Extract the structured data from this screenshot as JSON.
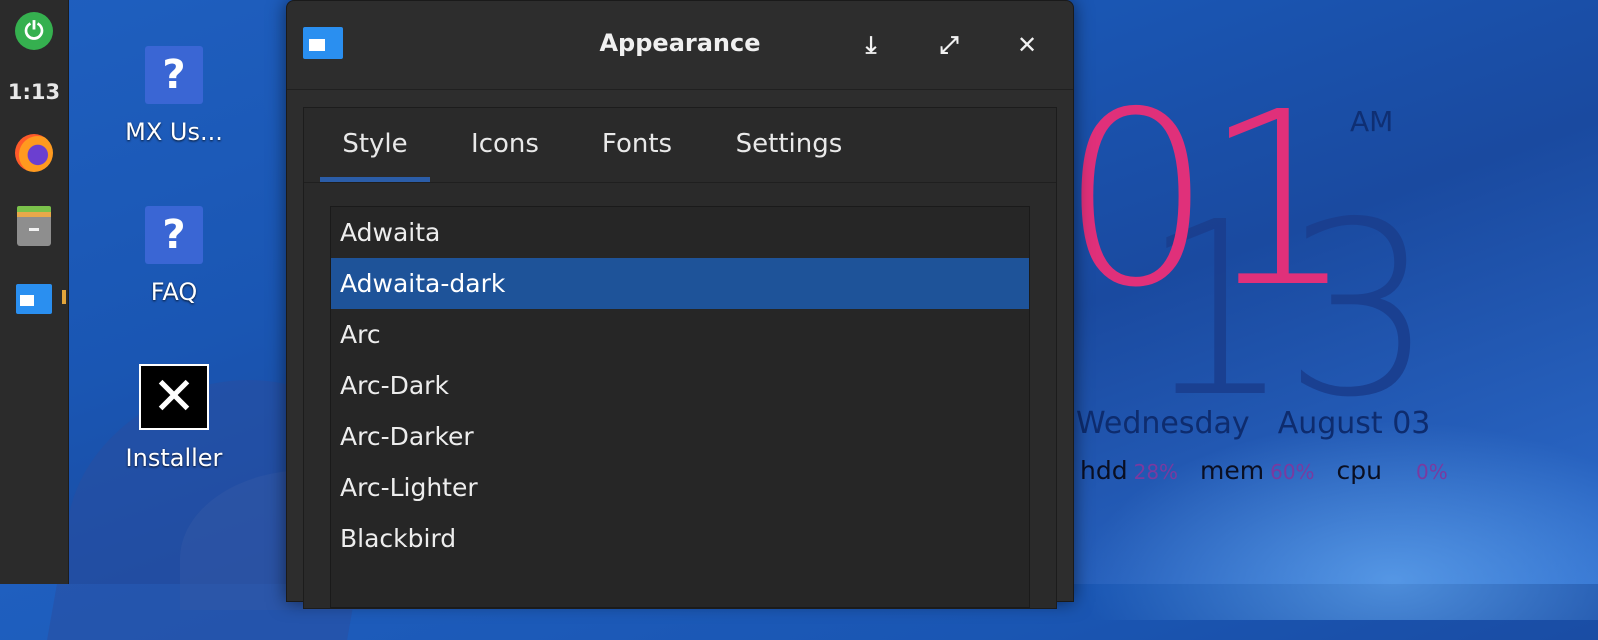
{
  "panel": {
    "clock": "1:13"
  },
  "desktop": {
    "icons": [
      {
        "label": "MX Us...",
        "icon": "question-icon"
      },
      {
        "label": "FAQ",
        "icon": "question-icon"
      },
      {
        "label": "Installer",
        "icon": "mx-installer-icon"
      }
    ]
  },
  "conky": {
    "hour": "01",
    "minute": "13",
    "ampm": "AM",
    "weekday": "Wednesday",
    "date": "August 03",
    "stats": [
      {
        "label": "hdd",
        "value": "28%"
      },
      {
        "label": "mem",
        "value": "60%"
      },
      {
        "label": "cpu",
        "value": "0%"
      }
    ],
    "colors": {
      "hour": "#e0307a",
      "minute": "#1a3f8f",
      "stat_value": "#7a3aa0"
    }
  },
  "window": {
    "title": "Appearance",
    "buttons": {
      "download": "⤓",
      "maximize": "⤢",
      "close": "✕"
    },
    "tabs": [
      "Style",
      "Icons",
      "Fonts",
      "Settings"
    ],
    "active_tab": "Style",
    "themes": [
      "Adwaita",
      "Adwaita-dark",
      "Arc",
      "Arc-Dark",
      "Arc-Darker",
      "Arc-Lighter",
      "Blackbird"
    ],
    "selected_theme": "Adwaita-dark",
    "accent": "#1e5399"
  }
}
